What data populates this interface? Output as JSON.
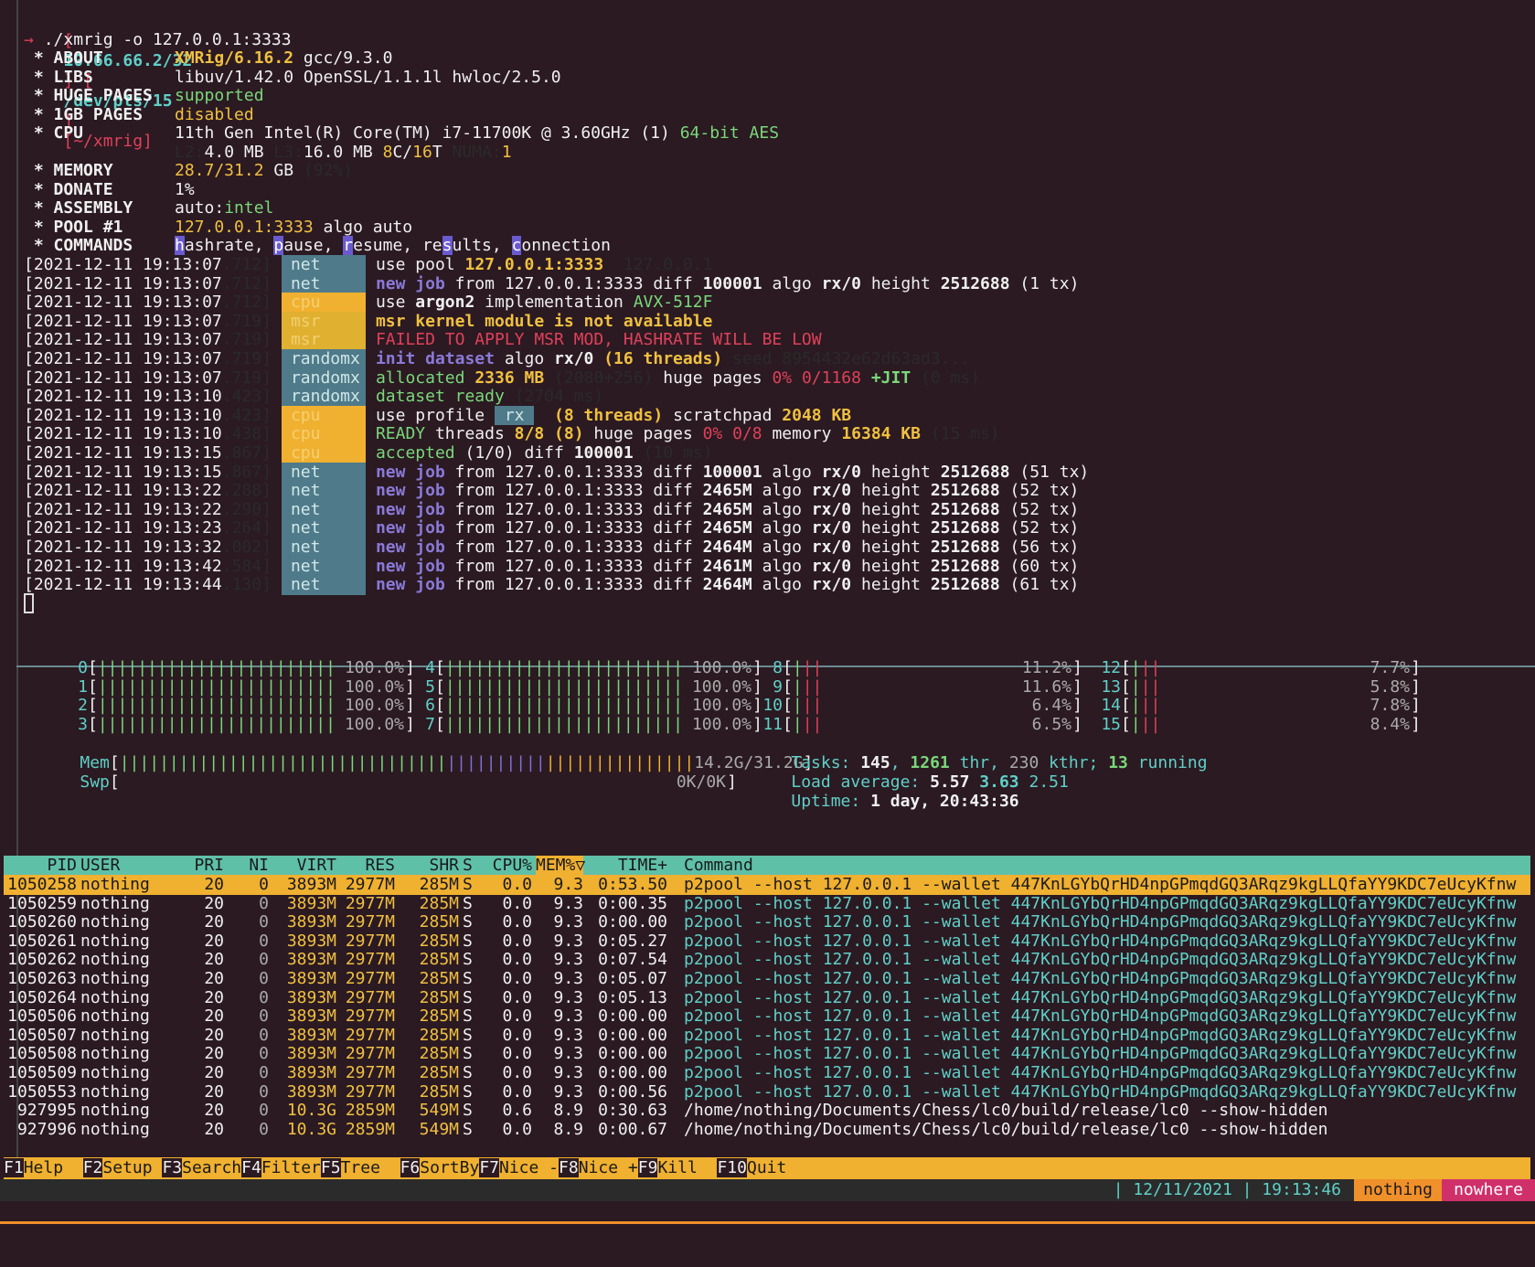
{
  "prompt": {
    "open": "[",
    "ip": "10.66.66.2/32",
    "sep1": "] [",
    "tty": "/dev/pts/15",
    "sep2": "]",
    "cwd": "[~/xmrig]",
    "arrow": "→",
    "command": "./xmrig -o 127.0.0.1:3333"
  },
  "info": [
    {
      "k": " * ABOUT",
      "parts": [
        [
          "XMRig/6.16.2",
          "c-yellow bold"
        ],
        [
          " gcc/9.3.0",
          "c-white"
        ]
      ]
    },
    {
      "k": " * LIBS",
      "parts": [
        [
          "libuv/1.42.0 OpenSSL/1.1.1l hwloc/2.5.0",
          "c-white"
        ]
      ]
    },
    {
      "k": " * HUGE PAGES",
      "parts": [
        [
          "supported",
          "c-green"
        ]
      ]
    },
    {
      "k": " * 1GB PAGES",
      "parts": [
        [
          "disabled",
          "c-yellow"
        ]
      ]
    },
    {
      "k": " * CPU",
      "parts": [
        [
          "11th Gen Intel(R) Core(TM) i7-11700K @ 3.60GHz (1) ",
          "c-white"
        ],
        [
          "64-bit AES",
          "c-green"
        ]
      ]
    },
    {
      "k": "",
      "parts": [
        [
          "L2:",
          "c-dim"
        ],
        [
          "4.0 MB ",
          "c-white"
        ],
        [
          "L3:",
          "c-dim"
        ],
        [
          "16.0 MB ",
          "c-white"
        ],
        [
          "8",
          "c-yellow"
        ],
        [
          "C/",
          "c-white"
        ],
        [
          "16",
          "c-yellow"
        ],
        [
          "T ",
          "c-white"
        ],
        [
          "NUMA:",
          "c-dim"
        ],
        [
          "1",
          "c-yellow"
        ]
      ]
    },
    {
      "k": " * MEMORY",
      "parts": [
        [
          "28.7/31.2",
          "c-yellow"
        ],
        [
          " GB ",
          "c-white"
        ],
        [
          "(92%)",
          "c-dim"
        ]
      ]
    },
    {
      "k": " * DONATE",
      "parts": [
        [
          "1%",
          "c-white"
        ]
      ]
    },
    {
      "k": " * ASSEMBLY",
      "parts": [
        [
          "auto:",
          "c-white"
        ],
        [
          "intel",
          "c-green"
        ]
      ]
    },
    {
      "k": " * POOL #1",
      "parts": [
        [
          "127.0.0.1:3333",
          "c-yellow"
        ],
        [
          " algo auto",
          "c-white"
        ]
      ]
    }
  ],
  "commands": {
    "key": " * COMMANDS",
    "items": [
      {
        "hl": "h",
        "rest": "ashrate, "
      },
      {
        "hl": "p",
        "rest": "ause, "
      },
      {
        "hl": "r",
        "rest": "esume, "
      },
      {
        "pre": "re",
        "hl": "s",
        "rest": "ults, "
      },
      {
        "hl": "c",
        "rest": "onnection"
      }
    ]
  },
  "log": [
    {
      "ts": "[2021-12-11 19:13:07",
      "ms": ".712]",
      "tag": "net",
      "tagc": "tag-net",
      "msg": [
        [
          "use pool ",
          "c-white"
        ],
        [
          "127.0.0.1:3333 ",
          "c-yellow bold"
        ],
        [
          " 127.0.0.1",
          "c-dim"
        ]
      ]
    },
    {
      "ts": "[2021-12-11 19:13:07",
      "ms": ".712]",
      "tag": "net",
      "tagc": "tag-net",
      "msg": [
        [
          "new job",
          "c-purple bold"
        ],
        [
          " from ",
          "c-white"
        ],
        [
          "127.0.0.1:3333",
          "c-white"
        ],
        [
          " diff ",
          "c-white"
        ],
        [
          "100001",
          "c-white bold"
        ],
        [
          " algo ",
          "c-white"
        ],
        [
          "rx/0",
          "c-white bold"
        ],
        [
          " height ",
          "c-white"
        ],
        [
          "2512688",
          "c-white bold"
        ],
        [
          " (1 tx)",
          "c-white"
        ]
      ]
    },
    {
      "ts": "[2021-12-11 19:13:07",
      "ms": ".712]",
      "tag": "cpu",
      "tagc": "tag-cpu",
      "msg": [
        [
          "use ",
          "c-white"
        ],
        [
          "argon2",
          "c-white bold"
        ],
        [
          " implementation ",
          "c-white"
        ],
        [
          "AVX-512F",
          "c-green"
        ]
      ]
    },
    {
      "ts": "[2021-12-11 19:13:07",
      "ms": ".719]",
      "tag": "msr",
      "tagc": "tag-msr",
      "msg": [
        [
          "msr kernel module is not available",
          "c-yellow bold"
        ]
      ]
    },
    {
      "ts": "[2021-12-11 19:13:07",
      "ms": ".719]",
      "tag": "msr",
      "tagc": "tag-msr",
      "msg": [
        [
          "FAILED TO APPLY MSR MOD, HASHRATE WILL BE LOW",
          "c-red"
        ]
      ]
    },
    {
      "ts": "[2021-12-11 19:13:07",
      "ms": ".719]",
      "tag": "randomx",
      "tagc": "tag-net",
      "msg": [
        [
          "init dataset",
          "c-purple bold"
        ],
        [
          " algo ",
          "c-white"
        ],
        [
          "rx/0 ",
          "c-white bold"
        ],
        [
          "(16 threads)",
          "c-yellow bold"
        ],
        [
          " seed 8954432e62d63ad3...",
          "c-dim"
        ]
      ]
    },
    {
      "ts": "[2021-12-11 19:13:07",
      "ms": ".719]",
      "tag": "randomx",
      "tagc": "tag-net",
      "msg": [
        [
          "allocated ",
          "c-green"
        ],
        [
          "2336 MB",
          "c-yellow bold"
        ],
        [
          " (2080+256)",
          "c-dim"
        ],
        [
          " huge pages ",
          "c-white"
        ],
        [
          "0% 0/1168 ",
          "c-red"
        ],
        [
          "+JIT",
          "c-green bold"
        ],
        [
          " (0 ms)",
          "c-dim"
        ]
      ]
    },
    {
      "ts": "[2021-12-11 19:13:10",
      "ms": ".423]",
      "tag": "randomx",
      "tagc": "tag-net",
      "msg": [
        [
          "dataset ready",
          "c-green"
        ],
        [
          " (2704 ms)",
          "c-dim"
        ]
      ]
    },
    {
      "ts": "[2021-12-11 19:13:10",
      "ms": ".423]",
      "tag": "cpu",
      "tagc": "tag-cpu",
      "msg": [
        [
          "use profile ",
          "c-white"
        ],
        [
          " rx ",
          "tag-rx"
        ],
        [
          "  (8 threads)",
          "c-yellow bold"
        ],
        [
          " scratchpad ",
          "c-white"
        ],
        [
          "2048 KB",
          "c-yellow bold"
        ]
      ]
    },
    {
      "ts": "[2021-12-11 19:13:10",
      "ms": ".438]",
      "tag": "cpu",
      "tagc": "tag-cpu",
      "msg": [
        [
          "READY",
          "c-green"
        ],
        [
          " threads ",
          "c-white"
        ],
        [
          "8/8 (8)",
          "c-yellow bold"
        ],
        [
          " huge pages ",
          "c-white"
        ],
        [
          "0% 0/8",
          "c-red"
        ],
        [
          " memory ",
          "c-white"
        ],
        [
          "16384 KB",
          "c-yellow bold"
        ],
        [
          " (15 ms)",
          "c-dim"
        ]
      ]
    },
    {
      "ts": "[2021-12-11 19:13:15",
      "ms": ".867]",
      "tag": "cpu",
      "tagc": "tag-cpu",
      "msg": [
        [
          "accepted",
          "c-green"
        ],
        [
          " (1/0) diff ",
          "c-white"
        ],
        [
          "100001",
          "c-white bold"
        ],
        [
          " (10 ms)",
          "c-dim"
        ]
      ]
    },
    {
      "ts": "[2021-12-11 19:13:15",
      "ms": ".867]",
      "tag": "net",
      "tagc": "tag-net",
      "msg": [
        [
          "new job",
          "c-purple bold"
        ],
        [
          " from 127.0.0.1:3333 diff ",
          "c-white"
        ],
        [
          "100001",
          "c-white bold"
        ],
        [
          " algo ",
          "c-white"
        ],
        [
          "rx/0",
          "c-white bold"
        ],
        [
          " height ",
          "c-white"
        ],
        [
          "2512688",
          "c-white bold"
        ],
        [
          " (51 tx)",
          "c-white"
        ]
      ]
    },
    {
      "ts": "[2021-12-11 19:13:22",
      "ms": ".288]",
      "tag": "net",
      "tagc": "tag-net",
      "msg": [
        [
          "new job",
          "c-purple bold"
        ],
        [
          " from 127.0.0.1:3333 diff ",
          "c-white"
        ],
        [
          "2465M",
          "c-white bold"
        ],
        [
          " algo ",
          "c-white"
        ],
        [
          "rx/0",
          "c-white bold"
        ],
        [
          " height ",
          "c-white"
        ],
        [
          "2512688",
          "c-white bold"
        ],
        [
          " (52 tx)",
          "c-white"
        ]
      ]
    },
    {
      "ts": "[2021-12-11 19:13:22",
      "ms": ".290]",
      "tag": "net",
      "tagc": "tag-net",
      "msg": [
        [
          "new job",
          "c-purple bold"
        ],
        [
          " from 127.0.0.1:3333 diff ",
          "c-white"
        ],
        [
          "2465M",
          "c-white bold"
        ],
        [
          " algo ",
          "c-white"
        ],
        [
          "rx/0",
          "c-white bold"
        ],
        [
          " height ",
          "c-white"
        ],
        [
          "2512688",
          "c-white bold"
        ],
        [
          " (52 tx)",
          "c-white"
        ]
      ]
    },
    {
      "ts": "[2021-12-11 19:13:23",
      "ms": ".264]",
      "tag": "net",
      "tagc": "tag-net",
      "msg": [
        [
          "new job",
          "c-purple bold"
        ],
        [
          " from 127.0.0.1:3333 diff ",
          "c-white"
        ],
        [
          "2465M",
          "c-white bold"
        ],
        [
          " algo ",
          "c-white"
        ],
        [
          "rx/0",
          "c-white bold"
        ],
        [
          " height ",
          "c-white"
        ],
        [
          "2512688",
          "c-white bold"
        ],
        [
          " (52 tx)",
          "c-white"
        ]
      ]
    },
    {
      "ts": "[2021-12-11 19:13:32",
      "ms": ".002]",
      "tag": "net",
      "tagc": "tag-net",
      "msg": [
        [
          "new job",
          "c-purple bold"
        ],
        [
          " from 127.0.0.1:3333 diff ",
          "c-white"
        ],
        [
          "2464M",
          "c-white bold"
        ],
        [
          " algo ",
          "c-white"
        ],
        [
          "rx/0",
          "c-white bold"
        ],
        [
          " height ",
          "c-white"
        ],
        [
          "2512688",
          "c-white bold"
        ],
        [
          " (56 tx)",
          "c-white"
        ]
      ]
    },
    {
      "ts": "[2021-12-11 19:13:42",
      "ms": ".584]",
      "tag": "net",
      "tagc": "tag-net",
      "msg": [
        [
          "new job",
          "c-purple bold"
        ],
        [
          " from 127.0.0.1:3333 diff ",
          "c-white"
        ],
        [
          "2461M",
          "c-white bold"
        ],
        [
          " algo ",
          "c-white"
        ],
        [
          "rx/0",
          "c-white bold"
        ],
        [
          " height ",
          "c-white"
        ],
        [
          "2512688",
          "c-white bold"
        ],
        [
          " (60 tx)",
          "c-white"
        ]
      ]
    },
    {
      "ts": "[2021-12-11 19:13:44",
      "ms": ".130]",
      "tag": "net",
      "tagc": "tag-net",
      "msg": [
        [
          "new job",
          "c-purple bold"
        ],
        [
          " from 127.0.0.1:3333 diff ",
          "c-white"
        ],
        [
          "2464M",
          "c-white bold"
        ],
        [
          " algo ",
          "c-white"
        ],
        [
          "rx/0",
          "c-white bold"
        ],
        [
          " height ",
          "c-white"
        ],
        [
          "2512688",
          "c-white bold"
        ],
        [
          " (61 tx)",
          "c-white"
        ]
      ]
    }
  ],
  "cpus": [
    {
      "id": "0",
      "val": "100.0%",
      "usage": 100
    },
    {
      "id": "1",
      "val": "100.0%",
      "usage": 100
    },
    {
      "id": "2",
      "val": "100.0%",
      "usage": 100
    },
    {
      "id": "3",
      "val": "100.0%",
      "usage": 100
    },
    {
      "id": "4",
      "val": "100.0%",
      "usage": 100
    },
    {
      "id": "5",
      "val": "100.0%",
      "usage": 100
    },
    {
      "id": "6",
      "val": "100.0%",
      "usage": 100
    },
    {
      "id": "7",
      "val": "100.0%",
      "usage": 100
    },
    {
      "id": "8",
      "val": "11.2%",
      "usage": 11.2
    },
    {
      "id": "9",
      "val": "11.6%",
      "usage": 11.6
    },
    {
      "id": "10",
      "val": "6.4%",
      "usage": 6.4
    },
    {
      "id": "11",
      "val": "6.5%",
      "usage": 6.5
    },
    {
      "id": "12",
      "val": "7.7%",
      "usage": 7.7
    },
    {
      "id": "13",
      "val": "5.8%",
      "usage": 5.8
    },
    {
      "id": "14",
      "val": "7.8%",
      "usage": 7.8
    },
    {
      "id": "15",
      "val": "8.4%",
      "usage": 8.4
    }
  ],
  "mem": {
    "label": "Mem",
    "val": "14.2G/31.2G"
  },
  "swp": {
    "label": "Swp",
    "val": "0K/0K"
  },
  "tasks": {
    "label": "Tasks: ",
    "count": "145",
    "sep1": ", ",
    "thr": "1261",
    "thr_label": " thr, ",
    "kthr": "230",
    "kthr_label": " kthr; ",
    "running": "13",
    "running_label": " running"
  },
  "load": {
    "label": "Load average: ",
    "l1": "5.57",
    "l5": "3.63",
    "l15": "2.51"
  },
  "uptime": {
    "label": "Uptime: ",
    "val": "1 day, 20:43:36"
  },
  "table": {
    "headers": [
      "PID",
      "USER",
      "PRI",
      "NI",
      "VIRT",
      "RES",
      "SHR",
      "S",
      "CPU%",
      "MEM%▽",
      "TIME+",
      "Command"
    ],
    "rows": [
      [
        "1050258",
        "nothing",
        "20",
        "0",
        "3893M",
        "2977M",
        "285M",
        "S",
        "0.0",
        "9.3",
        "0:53.50",
        "p2pool --host 127.0.0.1 --wallet 447KnLGYbQrHD4npGPmqdGQ3ARqz9kgLLQfaYY9KDC7eUcyKfnw"
      ],
      [
        "1050259",
        "nothing",
        "20",
        "0",
        "3893M",
        "2977M",
        "285M",
        "S",
        "0.0",
        "9.3",
        "0:00.35",
        "p2pool --host 127.0.0.1 --wallet 447KnLGYbQrHD4npGPmqdGQ3ARqz9kgLLQfaYY9KDC7eUcyKfnw"
      ],
      [
        "1050260",
        "nothing",
        "20",
        "0",
        "3893M",
        "2977M",
        "285M",
        "S",
        "0.0",
        "9.3",
        "0:00.00",
        "p2pool --host 127.0.0.1 --wallet 447KnLGYbQrHD4npGPmqdGQ3ARqz9kgLLQfaYY9KDC7eUcyKfnw"
      ],
      [
        "1050261",
        "nothing",
        "20",
        "0",
        "3893M",
        "2977M",
        "285M",
        "S",
        "0.0",
        "9.3",
        "0:05.27",
        "p2pool --host 127.0.0.1 --wallet 447KnLGYbQrHD4npGPmqdGQ3ARqz9kgLLQfaYY9KDC7eUcyKfnw"
      ],
      [
        "1050262",
        "nothing",
        "20",
        "0",
        "3893M",
        "2977M",
        "285M",
        "S",
        "0.0",
        "9.3",
        "0:07.54",
        "p2pool --host 127.0.0.1 --wallet 447KnLGYbQrHD4npGPmqdGQ3ARqz9kgLLQfaYY9KDC7eUcyKfnw"
      ],
      [
        "1050263",
        "nothing",
        "20",
        "0",
        "3893M",
        "2977M",
        "285M",
        "S",
        "0.0",
        "9.3",
        "0:05.07",
        "p2pool --host 127.0.0.1 --wallet 447KnLGYbQrHD4npGPmqdGQ3ARqz9kgLLQfaYY9KDC7eUcyKfnw"
      ],
      [
        "1050264",
        "nothing",
        "20",
        "0",
        "3893M",
        "2977M",
        "285M",
        "S",
        "0.0",
        "9.3",
        "0:05.13",
        "p2pool --host 127.0.0.1 --wallet 447KnLGYbQrHD4npGPmqdGQ3ARqz9kgLLQfaYY9KDC7eUcyKfnw"
      ],
      [
        "1050506",
        "nothing",
        "20",
        "0",
        "3893M",
        "2977M",
        "285M",
        "S",
        "0.0",
        "9.3",
        "0:00.00",
        "p2pool --host 127.0.0.1 --wallet 447KnLGYbQrHD4npGPmqdGQ3ARqz9kgLLQfaYY9KDC7eUcyKfnw"
      ],
      [
        "1050507",
        "nothing",
        "20",
        "0",
        "3893M",
        "2977M",
        "285M",
        "S",
        "0.0",
        "9.3",
        "0:00.00",
        "p2pool --host 127.0.0.1 --wallet 447KnLGYbQrHD4npGPmqdGQ3ARqz9kgLLQfaYY9KDC7eUcyKfnw"
      ],
      [
        "1050508",
        "nothing",
        "20",
        "0",
        "3893M",
        "2977M",
        "285M",
        "S",
        "0.0",
        "9.3",
        "0:00.00",
        "p2pool --host 127.0.0.1 --wallet 447KnLGYbQrHD4npGPmqdGQ3ARqz9kgLLQfaYY9KDC7eUcyKfnw"
      ],
      [
        "1050509",
        "nothing",
        "20",
        "0",
        "3893M",
        "2977M",
        "285M",
        "S",
        "0.0",
        "9.3",
        "0:00.00",
        "p2pool --host 127.0.0.1 --wallet 447KnLGYbQrHD4npGPmqdGQ3ARqz9kgLLQfaYY9KDC7eUcyKfnw"
      ],
      [
        "1050553",
        "nothing",
        "20",
        "0",
        "3893M",
        "2977M",
        "285M",
        "S",
        "0.0",
        "9.3",
        "0:00.56",
        "p2pool --host 127.0.0.1 --wallet 447KnLGYbQrHD4npGPmqdGQ3ARqz9kgLLQfaYY9KDC7eUcyKfnw"
      ],
      [
        "927995",
        "nothing",
        "20",
        "0",
        "10.3G",
        "2859M",
        "549M",
        "S",
        "0.6",
        "8.9",
        "0:30.63",
        "/home/nothing/Documents/Chess/lc0/build/release/lc0 --show-hidden"
      ],
      [
        "927996",
        "nothing",
        "20",
        "0",
        "10.3G",
        "2859M",
        "549M",
        "S",
        "0.0",
        "8.9",
        "0:00.67",
        "/home/nothing/Documents/Chess/lc0/build/release/lc0 --show-hidden"
      ]
    ]
  },
  "fkeys": [
    {
      "k": "F1",
      "l": "Help  "
    },
    {
      "k": "F2",
      "l": "Setup "
    },
    {
      "k": "F3",
      "l": "Search"
    },
    {
      "k": "F4",
      "l": "Filter"
    },
    {
      "k": "F5",
      "l": "Tree  "
    },
    {
      "k": "F6",
      "l": "SortBy"
    },
    {
      "k": "F7",
      "l": "Nice -"
    },
    {
      "k": "F8",
      "l": "Nice +"
    },
    {
      "k": "F9",
      "l": "Kill  "
    },
    {
      "k": "F10",
      "l": "Quit"
    }
  ],
  "status": {
    "date": "| 12/11/2021 | 19:13:46",
    "user": "nothing",
    "host": "nowhere"
  }
}
